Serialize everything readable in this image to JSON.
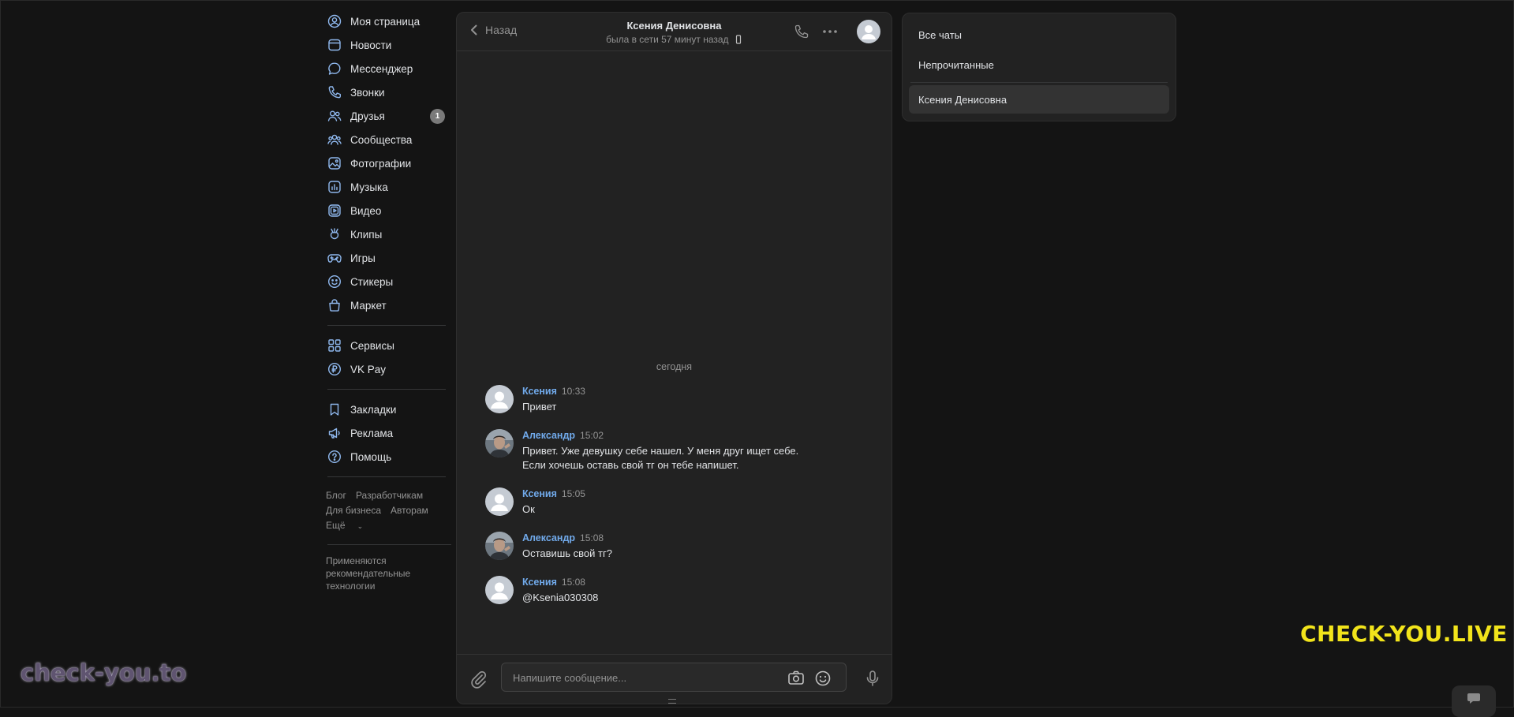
{
  "nav": {
    "items": [
      {
        "key": "mypage",
        "label": "Моя страница",
        "icon": "user-circle-icon"
      },
      {
        "key": "news",
        "label": "Новости",
        "icon": "newspaper-icon"
      },
      {
        "key": "messenger",
        "label": "Мессенджер",
        "icon": "chat-bubble-icon"
      },
      {
        "key": "calls",
        "label": "Звонки",
        "icon": "phone-icon"
      },
      {
        "key": "friends",
        "label": "Друзья",
        "icon": "friends-icon",
        "badge": "1"
      },
      {
        "key": "communities",
        "label": "Сообщества",
        "icon": "communities-icon"
      },
      {
        "key": "photos",
        "label": "Фотографии",
        "icon": "photo-icon"
      },
      {
        "key": "music",
        "label": "Музыка",
        "icon": "music-icon"
      },
      {
        "key": "video",
        "label": "Видео",
        "icon": "video-icon"
      },
      {
        "key": "clips",
        "label": "Клипы",
        "icon": "clips-icon"
      },
      {
        "key": "games",
        "label": "Игры",
        "icon": "gamepad-icon"
      },
      {
        "key": "stickers",
        "label": "Стикеры",
        "icon": "smile-icon"
      },
      {
        "key": "market",
        "label": "Маркет",
        "icon": "bag-icon"
      }
    ],
    "items2": [
      {
        "key": "services",
        "label": "Сервисы",
        "icon": "grid-icon"
      },
      {
        "key": "vkpay",
        "label": "VK Pay",
        "icon": "ruble-coin-icon"
      }
    ],
    "items3": [
      {
        "key": "bookmarks",
        "label": "Закладки",
        "icon": "bookmark-icon"
      },
      {
        "key": "ads",
        "label": "Реклама",
        "icon": "megaphone-icon"
      },
      {
        "key": "help",
        "label": "Помощь",
        "icon": "help-icon"
      }
    ],
    "footer": {
      "blog": "Блог",
      "developers": "Разработчикам",
      "business": "Для бизнеса",
      "authors": "Авторам",
      "more": "Ещё"
    },
    "note": "Применяются рекомендательные технологии"
  },
  "chat": {
    "back_label": "Назад",
    "peer_name": "Ксения Денисовна",
    "peer_status": "была в сети 57 минут назад",
    "day_label": "сегодня",
    "messages": [
      {
        "author": "Ксения",
        "time": "10:33",
        "text": "Привет",
        "avatar": "default"
      },
      {
        "author": "Александр",
        "time": "15:02",
        "text": "Привет. Уже девушку себе нашел. У меня друг ищет себе.\nЕсли хочешь оставь свой тг он тебе напишет.",
        "avatar": "photo"
      },
      {
        "author": "Ксения",
        "time": "15:05",
        "text": "Ок",
        "avatar": "default"
      },
      {
        "author": "Александр",
        "time": "15:08",
        "text": "Оставишь свой тг?",
        "avatar": "photo"
      },
      {
        "author": "Ксения",
        "time": "15:08",
        "text": "@Ksenia030308",
        "avatar": "default"
      }
    ],
    "composer": {
      "placeholder": "Напишите сообщение..."
    }
  },
  "right_panel": {
    "all_chats": "Все чаты",
    "unread": "Непрочитанные",
    "active_chat": "Ксения Денисовна"
  },
  "watermarks": {
    "yellow": "CHECK-YOU.LIVE",
    "purple": "check-you.to"
  },
  "colors": {
    "background": "#141414",
    "panel": "#222222",
    "accent_link": "#71aaeb",
    "icon_blue": "#8fb8ee",
    "watermark_yellow": "#f2e41b"
  }
}
